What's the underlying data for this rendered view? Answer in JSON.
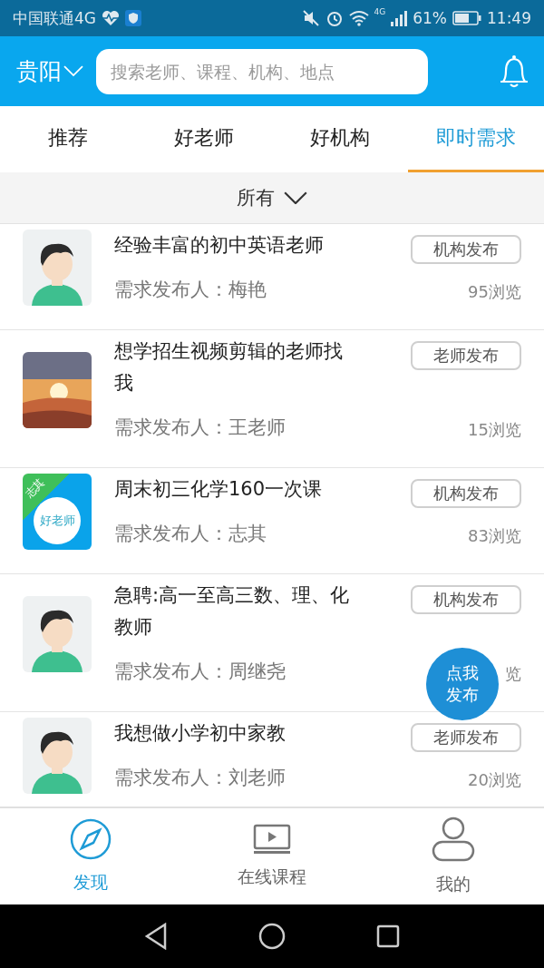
{
  "status_bar": {
    "carrier": "中国联通4G",
    "network": "4G",
    "battery": "61%",
    "time": "11:49"
  },
  "header": {
    "city": "贵阳",
    "search": {
      "placeholder": "搜索老师、课程、机构、地点"
    }
  },
  "tabs": [
    {
      "label": "推荐",
      "selected": false
    },
    {
      "label": "好老师",
      "selected": false
    },
    {
      "label": "好机构",
      "selected": false
    },
    {
      "label": "即时需求",
      "selected": true
    }
  ],
  "filter": {
    "label": "所有"
  },
  "demands": [
    {
      "avatar": {
        "kind": "boy"
      },
      "title": "经验丰富的初中英语老师",
      "publisher": "需求发布人：梅艳",
      "tag": "机构发布",
      "views": "95浏览"
    },
    {
      "title": "想学招生视频剪辑的老师找我",
      "publisher": "需求发布人：王老师",
      "tag": "老师发布",
      "views": "15浏览"
    },
    {
      "avatar": {
        "kind": "logo",
        "badge": "志其",
        "label": "好老师"
      },
      "title": "周末初三化学160一次课",
      "publisher": "需求发布人：志其",
      "tag": "机构发布",
      "views": "83浏览"
    },
    {
      "avatar": {
        "kind": "boy"
      },
      "title": "急聘:高一至高三数、理、化教师",
      "publisher": "需求发布人：周继尧",
      "tag": "机构发布",
      "views": "览"
    },
    {
      "avatar": {
        "kind": "boy"
      },
      "title": "我想做小学初中家教",
      "publisher": "需求发布人：刘老师",
      "tag": "老师发布",
      "views": "20浏览"
    }
  ],
  "fab": {
    "label": "点我发布"
  },
  "bottom_tabs": [
    {
      "label": "发现",
      "selected": true
    },
    {
      "label": "在线课程",
      "selected": false
    },
    {
      "label": "我的",
      "selected": false
    }
  ]
}
